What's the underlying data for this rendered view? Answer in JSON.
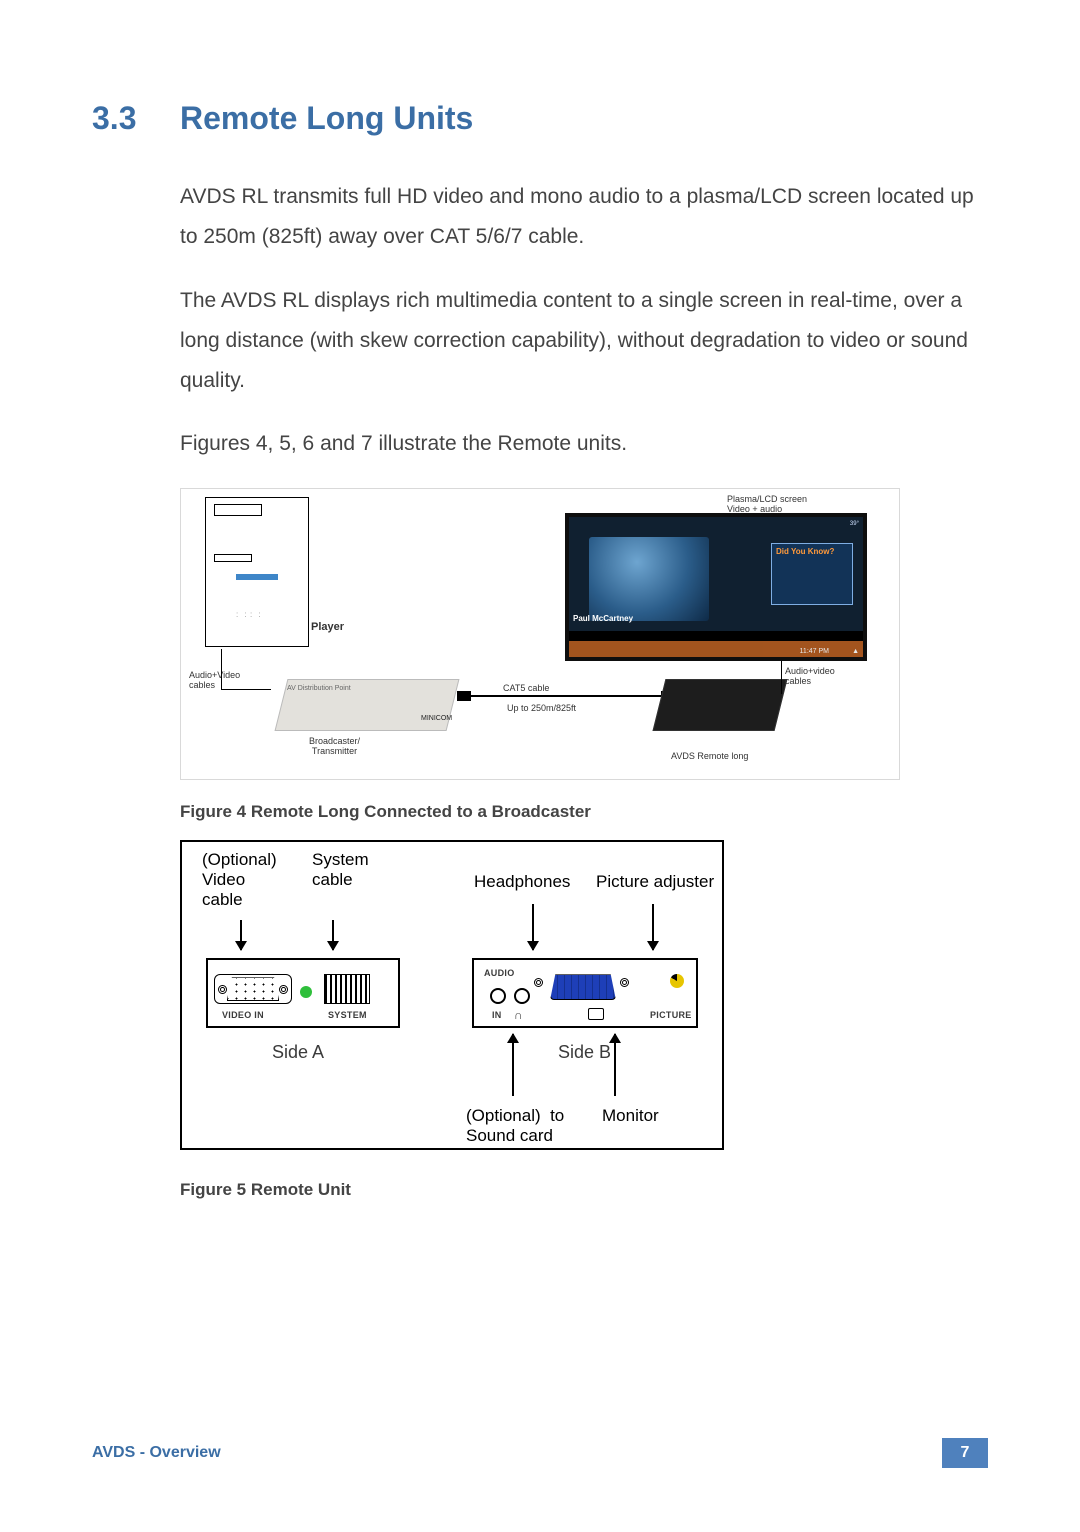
{
  "heading": {
    "number": "3.3",
    "title": "Remote Long Units"
  },
  "para1": "AVDS RL transmits full HD video and mono audio to a plasma/LCD screen located up to 250m (825ft) away over CAT 5/6/7 cable.",
  "para2": "The AVDS RL displays rich multimedia content to a single screen in real-time, over a long distance (with skew correction capability), without degradation to video or sound quality.",
  "para3": "Figures 4, 5, 6 and 7 illustrate the Remote units.",
  "fig4": {
    "caption": "Figure 4 Remote Long Connected to a Broadcaster",
    "labels": {
      "player": "Player",
      "av_cable_left": "Audio+Video\ncables",
      "broadcaster": "Broadcaster/\nTransmitter",
      "transmitter_side": "AV Distribution Point",
      "transmitter_code": "MINICOM",
      "cat5": "CAT5 cable",
      "upto": "Up to 250m/825ft",
      "remote_long": "AVDS Remote long",
      "av_cable_right": "Audio+video\ncables",
      "screen_label": "Plasma/LCD screen\nVideo + audio",
      "screen_didyou": "Did You Know?",
      "screen_name": "Paul McCartney",
      "screen_clock": "11:47 PM",
      "screen_tr": "39°"
    }
  },
  "fig5": {
    "caption": "Figure 5 Remote Unit",
    "labels": {
      "optional_video": "(Optional)\nVideo\ncable",
      "system_cable": "System\ncable",
      "headphones": "Headphones",
      "picture_adjuster": "Picture adjuster",
      "video_in": "VIDEO IN",
      "system": "SYSTEM",
      "audio": "AUDIO",
      "in": "IN",
      "hp": "∩",
      "picture": "PICTURE",
      "side_a": "Side A",
      "side_b": "Side B",
      "optional_sound": "(Optional)  to\nSound card",
      "monitor": "Monitor"
    }
  },
  "footer": {
    "left": "AVDS - Overview",
    "page": "7"
  }
}
